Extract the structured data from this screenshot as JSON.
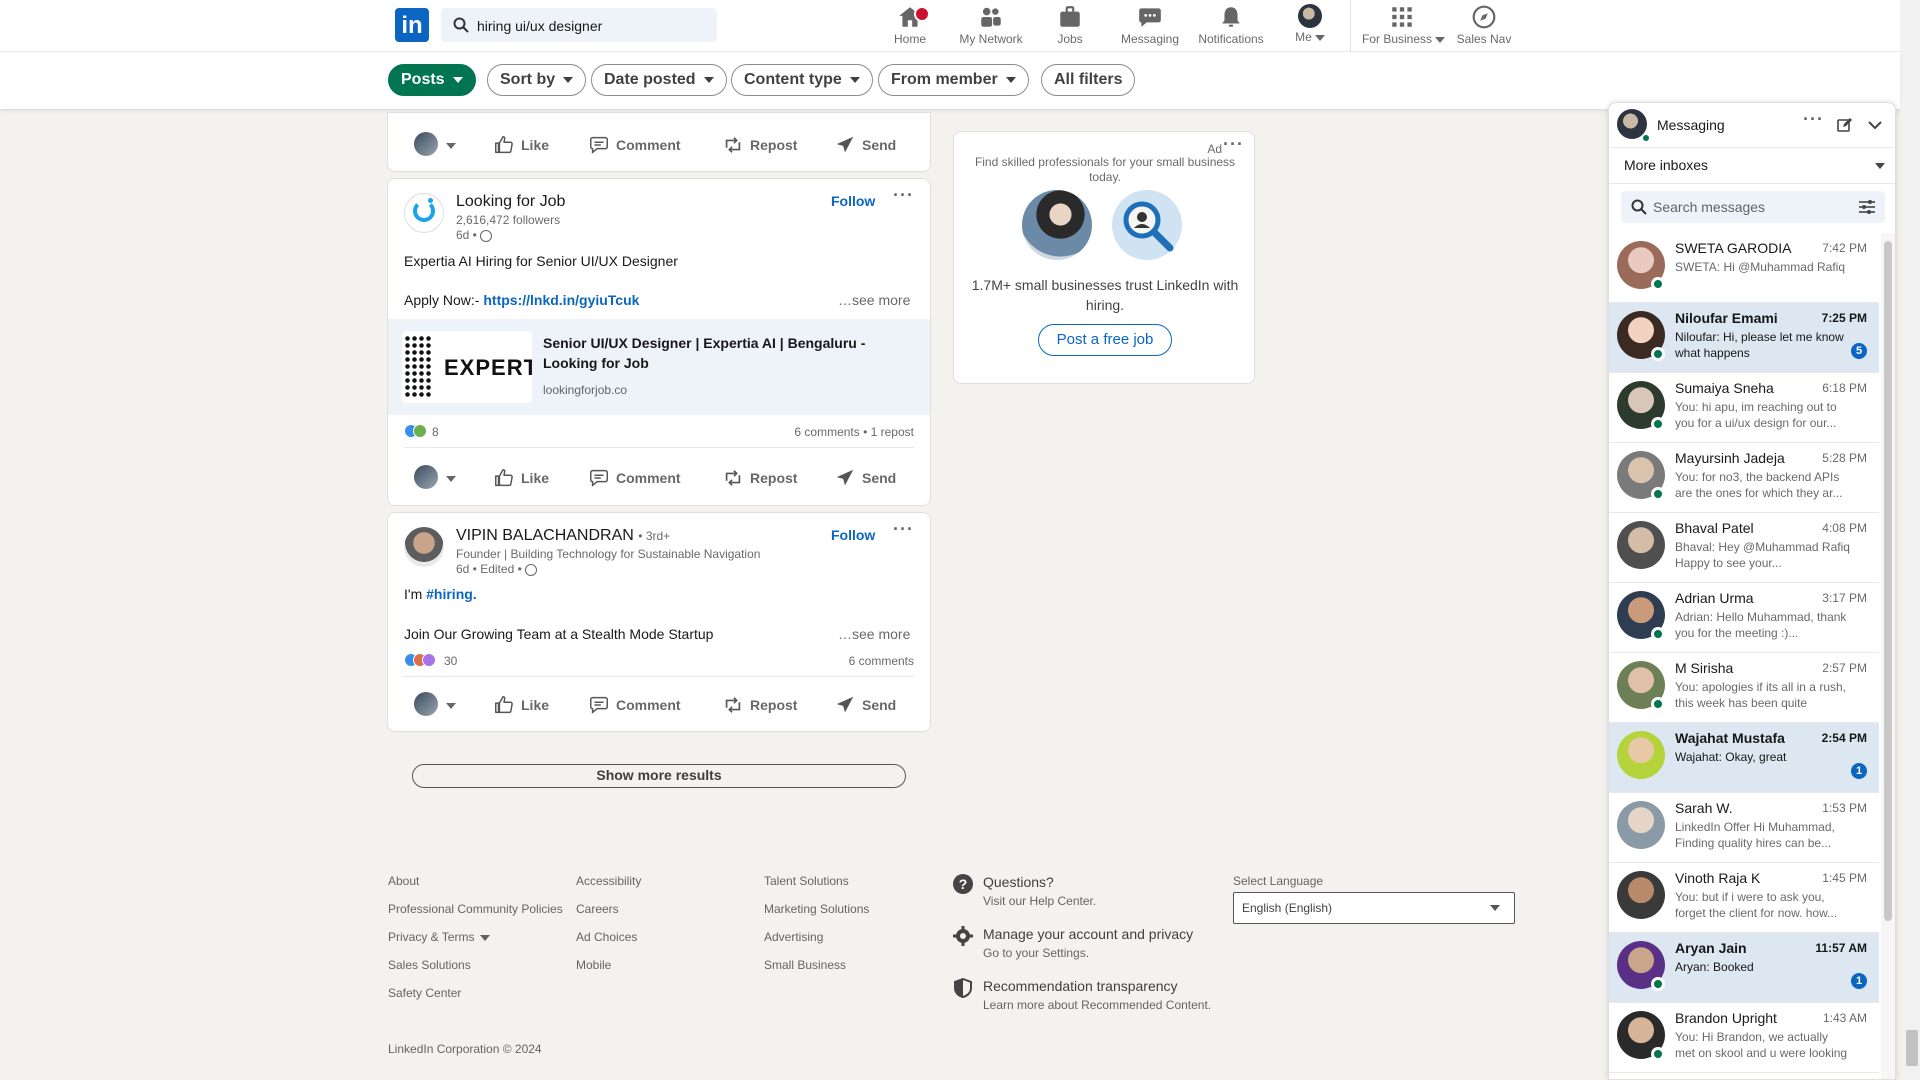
{
  "nav": {
    "search_value": "hiring ui/ux designer",
    "items": [
      {
        "label": "Home",
        "icon": "home-icon"
      },
      {
        "label": "My Network",
        "icon": "network-icon"
      },
      {
        "label": "Jobs",
        "icon": "jobs-icon"
      },
      {
        "label": "Messaging",
        "icon": "messaging-icon"
      },
      {
        "label": "Notifications",
        "icon": "bell-icon"
      },
      {
        "label": "Me",
        "icon": "avatar"
      },
      {
        "label": "For Business",
        "icon": "grid-icon"
      },
      {
        "label": "Sales Nav",
        "icon": "compass-icon"
      }
    ]
  },
  "filters": {
    "posts": "Posts",
    "sort_by": "Sort by",
    "date_posted": "Date posted",
    "content_type": "Content type",
    "from_member": "From member",
    "all_filters": "All filters"
  },
  "actions": {
    "like": "Like",
    "comment": "Comment",
    "repost": "Repost",
    "send": "Send"
  },
  "posts": [
    {
      "author": "Looking for Job",
      "followers": "2,616,472 followers",
      "age": "6d •",
      "follow": "Follow",
      "line1": "Expertia AI Hiring for Senior UI/UX Designer",
      "line2_prefix": "Apply Now:-",
      "link": "https://lnkd.in/gyiuTcuk",
      "see_more": "…see more",
      "preview_logo_text": "EXPERTI",
      "preview_title_1": "Senior UI/UX Designer | Expertia AI | Bengaluru -",
      "preview_title_2": "Looking for Job",
      "preview_domain": "lookingforjob.co",
      "reactions": "8",
      "stats": "6 comments • 1 repost"
    },
    {
      "author": "VIPIN BALACHANDRAN",
      "degree": "• 3rd+",
      "headline": "Founder | Building Technology for Sustainable Navigation",
      "age": "6d • Edited •",
      "follow": "Follow",
      "line1_prefix": "I'm",
      "hashtag": "#hiring.",
      "line2": "Join Our Growing Team at a Stealth Mode Startup",
      "see_more": "…see more",
      "reactions": "30",
      "stats": "6 comments"
    }
  ],
  "show_more": "Show more results",
  "ad": {
    "label": "Ad",
    "tagline": "Find skilled professionals for your small business today.",
    "trust": "1.7M+ small businesses trust LinkedIn with hiring.",
    "cta": "Post a free job"
  },
  "footer": {
    "col1": [
      "About",
      "Professional Community Policies",
      "Privacy & Terms",
      "Sales Solutions",
      "Safety Center"
    ],
    "col2": [
      "Accessibility",
      "Careers",
      "Ad Choices",
      "Mobile"
    ],
    "col3": [
      "Talent Solutions",
      "Marketing Solutions",
      "Advertising",
      "Small Business"
    ],
    "help": [
      {
        "title": "Questions?",
        "sub": "Visit our Help Center."
      },
      {
        "title": "Manage your account and privacy",
        "sub": "Go to your Settings."
      },
      {
        "title": "Recommendation transparency",
        "sub": "Learn more about Recommended Content."
      }
    ],
    "lang_label": "Select Language",
    "lang_value": "English (English)",
    "copyright": "LinkedIn Corporation © 2024"
  },
  "messaging": {
    "title": "Messaging",
    "inboxes": "More inboxes",
    "search_placeholder": "Search messages",
    "conversations": [
      {
        "name": "SWETA GARODIA",
        "time": "7:42 PM",
        "preview": "SWETA: Hi @Muhammad Rafiq",
        "unread": false,
        "count": ""
      },
      {
        "name": "Niloufar Emami",
        "time": "7:25 PM",
        "preview": "Niloufar: Hi, please let me know what happens",
        "unread": true,
        "count": "5"
      },
      {
        "name": "Sumaiya Sneha",
        "time": "6:18 PM",
        "preview": "You: hi apu, im reaching out to you for a ui/ux design for our...",
        "unread": false,
        "count": ""
      },
      {
        "name": "Mayursinh Jadeja",
        "time": "5:28 PM",
        "preview": "You: for no3, the backend APIs are the ones for which they ar...",
        "unread": false,
        "count": ""
      },
      {
        "name": "Bhaval Patel",
        "time": "4:08 PM",
        "preview": "Bhaval: Hey @Muhammad Rafiq Happy to see your...",
        "unread": false,
        "count": ""
      },
      {
        "name": "Adrian Urma",
        "time": "3:17 PM",
        "preview": "Adrian: Hello Muhammad, thank you for the meeting :)...",
        "unread": false,
        "count": ""
      },
      {
        "name": "M Sirisha",
        "time": "2:57 PM",
        "preview": "You: apologies if its all in a rush, this week has been quite heavy...",
        "unread": false,
        "count": ""
      },
      {
        "name": "Wajahat Mustafa",
        "time": "2:54 PM",
        "preview": "Wajahat: Okay, great",
        "unread": true,
        "count": "1"
      },
      {
        "name": "Sarah W.",
        "time": "1:53 PM",
        "preview": "LinkedIn Offer  Hi Muhammad, Finding quality hires can be...",
        "unread": false,
        "count": ""
      },
      {
        "name": "Vinoth Raja K",
        "time": "1:45 PM",
        "preview": "You: but if i were to ask you, forget the client for now. how...",
        "unread": false,
        "count": ""
      },
      {
        "name": "Aryan Jain",
        "time": "11:57 AM",
        "preview": "Aryan: Booked",
        "unread": true,
        "count": "1"
      },
      {
        "name": "Brandon Upright",
        "time": "1:43 AM",
        "preview": "You: Hi Brandon, we actually met on skool and u were looking for...",
        "unread": false,
        "count": ""
      }
    ]
  },
  "colors": {
    "brand": "#0a66c2",
    "green": "#01754f",
    "unread_bg": "#dde7f1"
  }
}
